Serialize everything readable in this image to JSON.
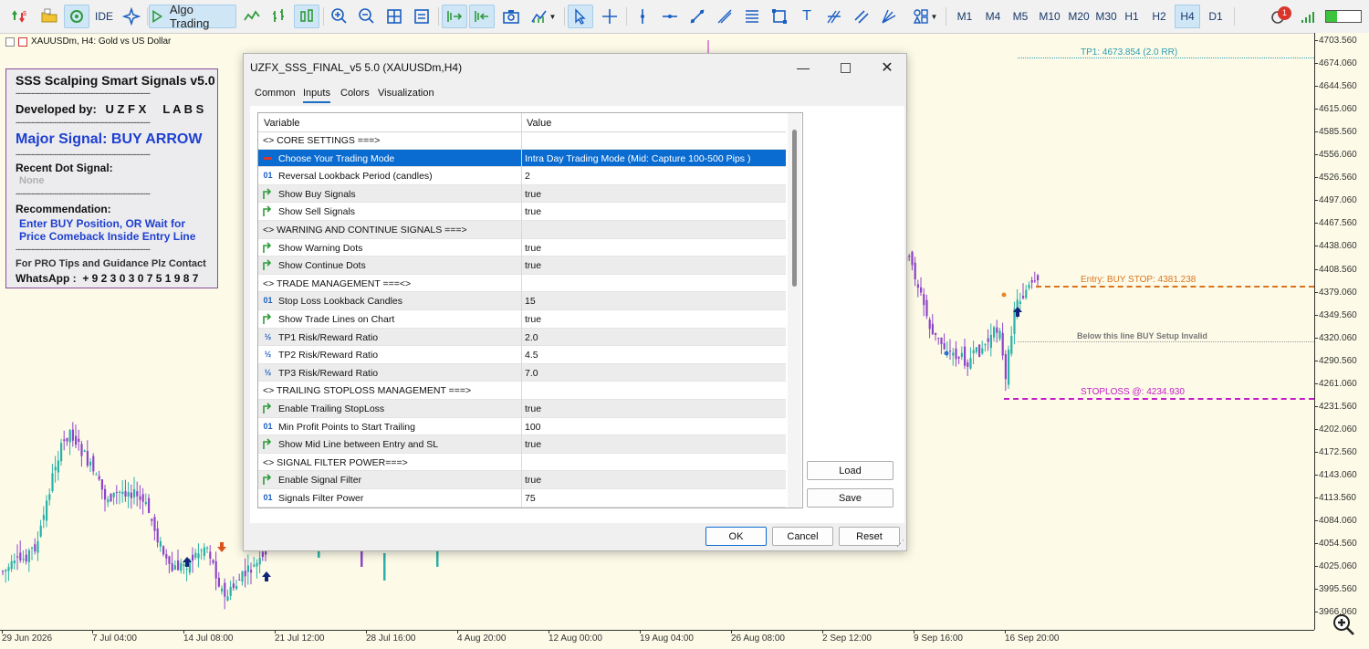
{
  "toolbar": {
    "ide_label": "IDE",
    "algo_label": "Algo Trading",
    "timeframes": [
      "M1",
      "M4",
      "M5",
      "M10",
      "M20",
      "M30",
      "H1",
      "H2",
      "H4",
      "D1"
    ],
    "active_timeframe": "H4",
    "notification_count": "1"
  },
  "chart": {
    "title": "XAUUSDm, H4:  Gold vs US Dollar",
    "price_labels": [
      "4703.560",
      "4674.060",
      "4644.560",
      "4615.060",
      "4585.560",
      "4556.060",
      "4526.560",
      "4497.060",
      "4467.560",
      "4438.060",
      "4408.560",
      "4379.060",
      "4349.560",
      "4320.060",
      "4290.560",
      "4261.060",
      "4231.560",
      "4202.060",
      "4172.560",
      "4143.060",
      "4113.560",
      "4084.060",
      "4054.560",
      "4025.060",
      "3995.560",
      "3966.060"
    ],
    "time_labels": [
      "29 Jun 2026",
      "7 Jul 04:00",
      "14 Jul 08:00",
      "21 Jul 12:00",
      "28 Jul 16:00",
      "4 Aug 20:00",
      "12 Aug 00:00",
      "19 Aug 04:00",
      "26 Aug 08:00",
      "2 Sep 12:00",
      "9 Sep 16:00",
      "16 Sep 20:00"
    ],
    "tp1_label": "TP1: 4673.854 (2.0 RR)",
    "entry_label": "Entry: BUY STOP: 4381.238",
    "invalid_label": "Below this line BUY Setup Invalid",
    "sl_label": "STOPLOSS @: 4234.930",
    "colors": {
      "tp": "#2a9bb0",
      "entry": "#d9741e",
      "sl": "#c21cc7",
      "bull": "#2bb0a8",
      "bear": "#8e44c9"
    }
  },
  "info_panel": {
    "title": "SSS Scalping Smart Signals v5.0",
    "dashes": "-----------------------------------------------------------",
    "developed_label": "Developed by:",
    "developer": "U Z F X     L A B S",
    "major_signal": "Major Signal: BUY ARROW",
    "recent_dot_label": "Recent Dot Signal:",
    "recent_dot_value": "None",
    "recommendation_label": "Recommendation:",
    "recommendation_line1": "Enter BUY Position, OR Wait for",
    "recommendation_line2": "Price Comeback Inside Entry Line",
    "contact_line": "For PRO Tips and Guidance Plz Contact",
    "whatsapp": "WhatsApp :  + 9 2 3 0 3 0 7 5 1 9 8 7"
  },
  "dialog": {
    "title": "UZFX_SSS_FINAL_v5 5.0 (XAUUSDm,H4)",
    "tabs": [
      "Common",
      "Inputs",
      "Colors",
      "Visualization"
    ],
    "selected_tab": "Inputs",
    "col_variable": "Variable",
    "col_value": "Value",
    "rows": [
      {
        "icon": "section",
        "name": "<> CORE SETTINGS ===>",
        "value": ""
      },
      {
        "icon": "enum",
        "name": "Choose Your Trading Mode",
        "value": "Intra Day Trading Mode (Mid: Capture 100-500 Pips )"
      },
      {
        "icon": "int",
        "name": "Reversal Lookback Period (candles)",
        "value": "2"
      },
      {
        "icon": "bool",
        "name": "Show Buy Signals",
        "value": "true"
      },
      {
        "icon": "bool",
        "name": "Show Sell Signals",
        "value": "true"
      },
      {
        "icon": "section",
        "name": "<> WARNING AND CONTINUE SIGNALS ===>",
        "value": ""
      },
      {
        "icon": "bool",
        "name": "Show Warning Dots",
        "value": "true"
      },
      {
        "icon": "bool",
        "name": "Show Continue Dots",
        "value": "true"
      },
      {
        "icon": "section",
        "name": "<> TRADE MANAGEMENT ===<>",
        "value": ""
      },
      {
        "icon": "int",
        "name": "Stop Loss Lookback Candles",
        "value": "15"
      },
      {
        "icon": "bool",
        "name": "Show Trade Lines on Chart",
        "value": "true"
      },
      {
        "icon": "double",
        "name": "TP1 Risk/Reward Ratio",
        "value": "2.0"
      },
      {
        "icon": "double",
        "name": "TP2 Risk/Reward Ratio",
        "value": "4.5"
      },
      {
        "icon": "double",
        "name": "TP3 Risk/Reward Ratio",
        "value": "7.0"
      },
      {
        "icon": "section",
        "name": "<> TRAILING STOPLOSS MANAGEMENT ===>",
        "value": ""
      },
      {
        "icon": "bool",
        "name": "Enable Trailing StopLoss",
        "value": "true"
      },
      {
        "icon": "int",
        "name": "Min Profit Points to Start Trailing",
        "value": "100"
      },
      {
        "icon": "bool",
        "name": "Show Mid Line between Entry and SL",
        "value": "true"
      },
      {
        "icon": "section",
        "name": "<> SIGNAL FILTER POWER===>",
        "value": ""
      },
      {
        "icon": "bool",
        "name": "Enable Signal Filter",
        "value": "true"
      },
      {
        "icon": "int",
        "name": "Signals Filter Power",
        "value": "75"
      }
    ],
    "selected_row": 1,
    "load_label": "Load",
    "save_label": "Save",
    "ok_label": "OK",
    "cancel_label": "Cancel",
    "reset_label": "Reset"
  }
}
